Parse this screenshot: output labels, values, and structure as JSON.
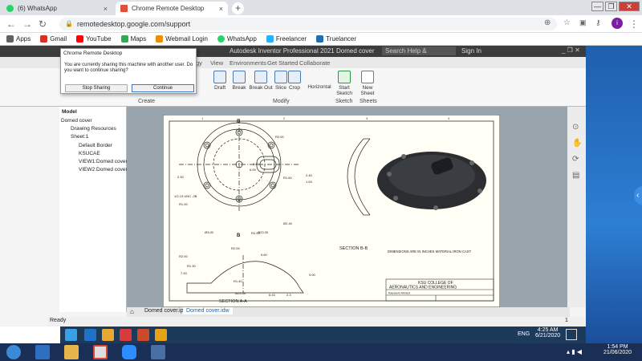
{
  "browser": {
    "tabs": [
      {
        "label": "(6) WhatsApp",
        "close": "×"
      },
      {
        "label": "Chrome Remote Desktop",
        "close": "×"
      }
    ],
    "new_tab": "+",
    "window_controls": [
      "—",
      "❐",
      "✕"
    ],
    "url": "remotedesktop.google.com/support",
    "bookmarks": [
      "Apps",
      "Gmail",
      "YouTube",
      "Maps",
      "Webmail Login",
      "WhatsApp",
      "Freelancer",
      "Truelancer"
    ],
    "avatar_letter": "i"
  },
  "inventor": {
    "title": "Autodesk Inventor Professional 2021    Domed  cover",
    "search_placeholder": "Search Help & Commands...",
    "sign_in": "Sign In",
    "ribbon_tabs": [
      "gy",
      "View",
      "Environments",
      "Get Started",
      "Collaborate"
    ],
    "ribbon_buttons": [
      "Draft",
      "Break",
      "Break Out",
      "Slice",
      "Crop",
      "Horizontal",
      "Start Sketch",
      "New Sheet"
    ],
    "groups": [
      "Create",
      "Modify",
      "Sketch",
      "Sheets"
    ],
    "browser_header": "Model",
    "tree": [
      "Domed  cover",
      "Drawing Resources",
      "Sheet:1",
      "Default Border",
      "KSUCAE",
      "VIEW1:Domed cover.ip",
      "VIEW2:Domed cover.ip"
    ],
    "doc_tabs": [
      "Domed cover.ipt",
      "Domed  cover.idw"
    ],
    "status": "Ready",
    "status_right": "1"
  },
  "popup": {
    "title": "Chrome Remote Desktop",
    "message": "You are currently sharing this machine with another user. Do you want to continue sharing?",
    "stop_label": "Stop Sharing",
    "continue_label": "Continue"
  },
  "drawing": {
    "section_bb": "SECTION B-B",
    "section_aa": "SECTION A-A",
    "notes": "DIMENSIONS ARE IN INCHES\nMATERIAL:IRON CAST",
    "college_line1": "KSU COLLEGE OF",
    "college_line2": "AERONAUTICS AND ENGINEERING",
    "author": "Kauseem Ahmed",
    "dims": [
      "R2.00",
      "3.00",
      "6.00",
      "2.40",
      "R1.60",
      "2.40",
      "1.63",
      "R2.00",
      "Ø3.00",
      "Ø2.40",
      "R2.00",
      "Ø23.30",
      "Ø27.30",
      "1 1/4-7 UNC -2B",
      "R2.00",
      "R1.30",
      "7.43",
      "R1.40",
      "Ø23.30",
      "5.60",
      "9.00",
      "6.43",
      "2.3",
      "1/2-13 UNC -2B",
      "R1.00"
    ],
    "view_letters": [
      "B",
      "B",
      "A",
      "A"
    ],
    "zones": [
      "1",
      "2",
      "3",
      "4",
      "5",
      "6"
    ]
  },
  "remote_taskbar": {
    "lang": "ENG",
    "time": "4:25 AM",
    "date": "6/21/2020"
  },
  "local_taskbar": {
    "time": "1:54 PM",
    "date": "21/06/2020"
  },
  "side_arrow": "‹"
}
